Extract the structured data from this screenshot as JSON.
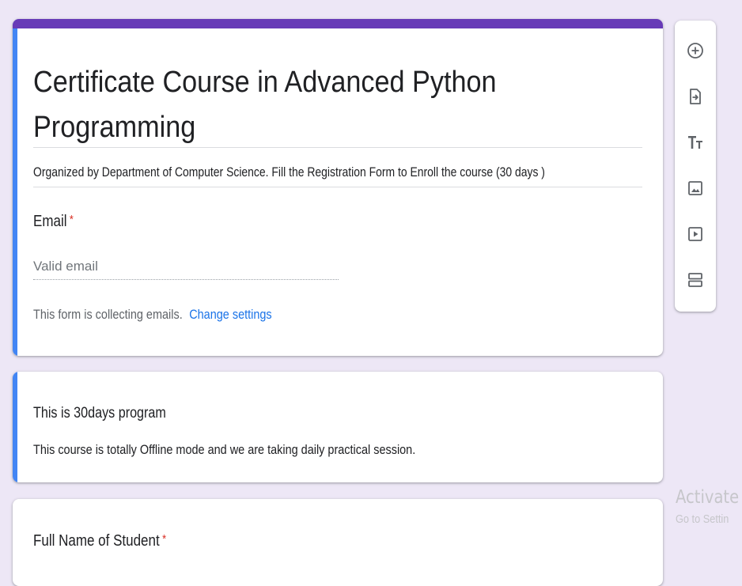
{
  "form": {
    "title": "Certificate Course in  Advanced Python Programming",
    "description": "Organized by Department of Computer Science. Fill the Registration Form to Enroll the course (30 days )",
    "email": {
      "label": "Email",
      "required_mark": "*",
      "placeholder": "Valid email",
      "collecting_note": "This form is collecting emails.",
      "change_settings": "Change settings"
    }
  },
  "section": {
    "title": "This is 30days program",
    "description": "This course is totally Offline mode and we are taking daily practical session."
  },
  "question": {
    "label": "Full Name of Student",
    "required_mark": "*"
  },
  "toolbar": {
    "icons": [
      "add-question-icon",
      "import-questions-icon",
      "add-title-icon",
      "add-image-icon",
      "add-video-icon",
      "add-section-icon"
    ]
  },
  "watermark": {
    "line1": "Activate W",
    "line2": "Go to Settin"
  },
  "colors": {
    "header_accent": "#673ab7",
    "selected_bar": "#4285f4",
    "background": "#ede7f6",
    "link": "#1a73e8",
    "required": "#d93025"
  }
}
